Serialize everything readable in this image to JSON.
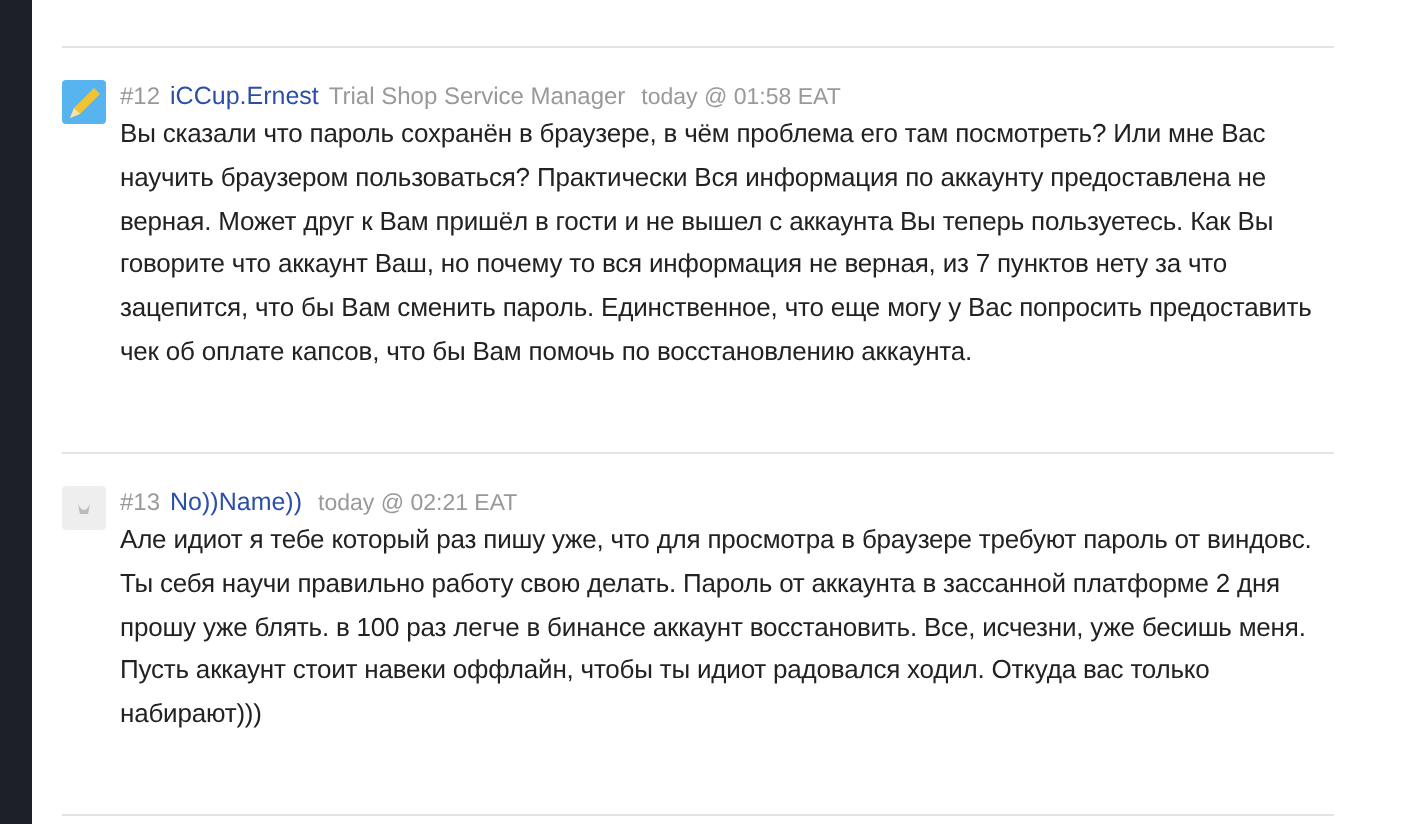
{
  "posts": [
    {
      "number": "#12",
      "author": "iCCup.Ernest",
      "role": "Trial Shop Service Manager",
      "time": "today @ 01:58 EAT",
      "avatar": {
        "kind": "pencil"
      },
      "text": "Вы сказали что пароль сохранён в браузере, в чём проблема его там посмотреть? Или мне Вас научить браузером пользоваться? Практически Вся информация по аккаунту предоставлена не верная. Может друг к Вам пришёл в гости и не вышел с аккаунта Вы теперь пользуетесь. Как Вы говорите что аккаунт Ваш, но почему то вся информация не верная, из 7 пунктов нету за что зацепится, что бы Вам сменить пароль. Единственное, что еще могу у Вас попросить предоставить чек об оплате капсов, что бы Вам помочь по восстановлению аккаунта."
    },
    {
      "number": "#13",
      "author": "No))Name))",
      "time": "today @ 02:21 EAT",
      "avatar": {
        "kind": "default"
      },
      "text": "Але идиот я тебе который раз пишу уже, что для просмотра в браузере требуют пароль от виндовс. Ты себя научи правильно работу свою делать. Пароль от аккаунта в зассанной платформе 2 дня прошу уже блять. в 100 раз легче в бинансе аккаунт восстановить. Все, исчезни, уже бесишь меня. Пусть аккаунт стоит навеки оффлайн, чтобы ты идиот радовался ходил. Откуда вас только набирают)))"
    }
  ]
}
